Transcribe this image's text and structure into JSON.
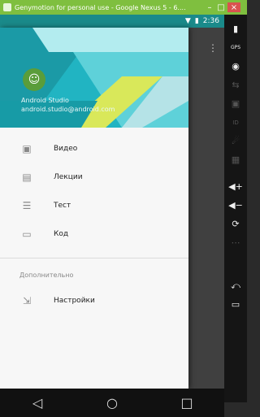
{
  "window": {
    "title": "Genymotion for personal use - Google Nexus 5 - 6....",
    "minimize": "–",
    "maximize": "□",
    "close": "×"
  },
  "statusbar": {
    "wifi": "▼",
    "battery": "▮",
    "time": "2:36"
  },
  "drawer": {
    "avatar_icon": "☺",
    "header_name": "Android Studio",
    "header_email": "android.studio@android.com",
    "items": [
      {
        "icon": "▣",
        "label": "Видео"
      },
      {
        "icon": "▤",
        "label": "Лекции"
      },
      {
        "icon": "☰",
        "label": "Тест"
      },
      {
        "icon": "▭",
        "label": "Код"
      }
    ],
    "section_title": "Дополнительно",
    "extra_items": [
      {
        "icon": "⇲",
        "label": "Настройки"
      }
    ]
  },
  "navbar": {
    "back": "◁",
    "home": "○",
    "recents": "□"
  },
  "sidebar_tools": [
    "▮",
    "GPS",
    "◉",
    "⇆",
    "▣",
    "ID",
    "☄",
    "▦",
    "◀+",
    "◀−",
    "⟳",
    "⋯",
    "⤺",
    "▭"
  ],
  "overflow_icon": "⋮"
}
